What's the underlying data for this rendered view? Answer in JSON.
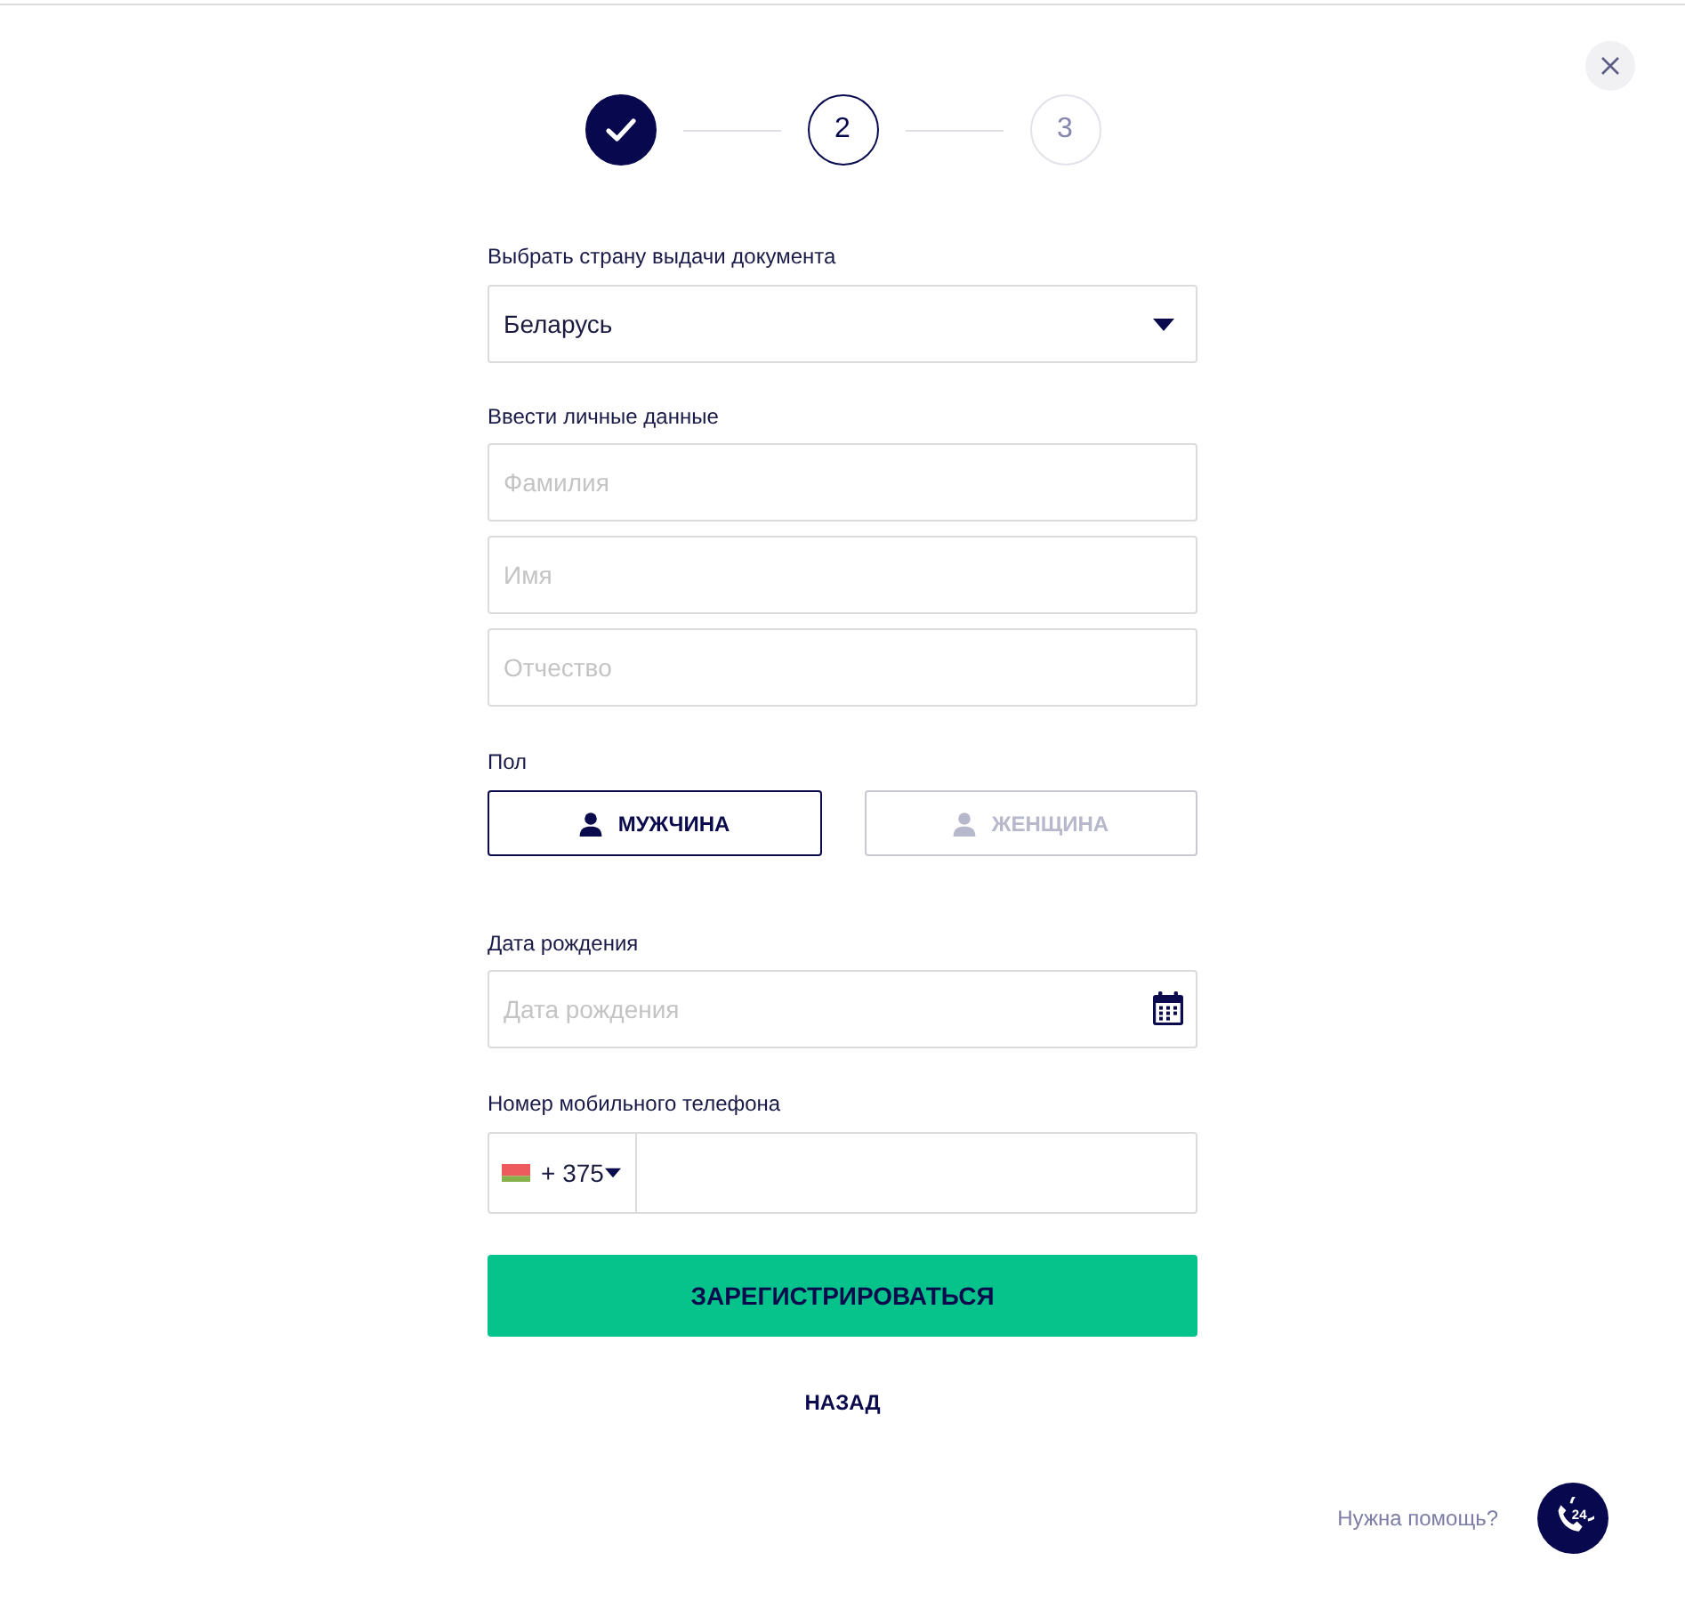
{
  "steps": [
    {
      "completed": true,
      "selected": false
    },
    {
      "label": "2",
      "completed": false,
      "selected": true
    },
    {
      "label": "3",
      "completed": false,
      "selected": false
    }
  ],
  "country": {
    "label": "Выбрать страну выдачи документа",
    "value": "Беларусь"
  },
  "personal_data": {
    "label": "Ввести личные данные",
    "fields": [
      {
        "placeholder": "Фамилия"
      },
      {
        "placeholder": "Имя"
      },
      {
        "placeholder": "Отчество"
      }
    ]
  },
  "gender": {
    "label": "Пол",
    "options": [
      {
        "label": "МУЖЧИНА",
        "selected": true
      },
      {
        "label": "ЖЕНЩИНА",
        "selected": false
      }
    ]
  },
  "birth_date": {
    "label": "Дата рождения",
    "placeholder": "Дата рождения"
  },
  "phone": {
    "label": "Номер мобильного телефона",
    "country_code": "+ 375"
  },
  "submit_button": "ЗАРЕГИСТРИРОВАТЬСЯ",
  "back_link": "НАЗАД",
  "help": {
    "text": "Нужна помощь?",
    "icon_text": "24"
  }
}
